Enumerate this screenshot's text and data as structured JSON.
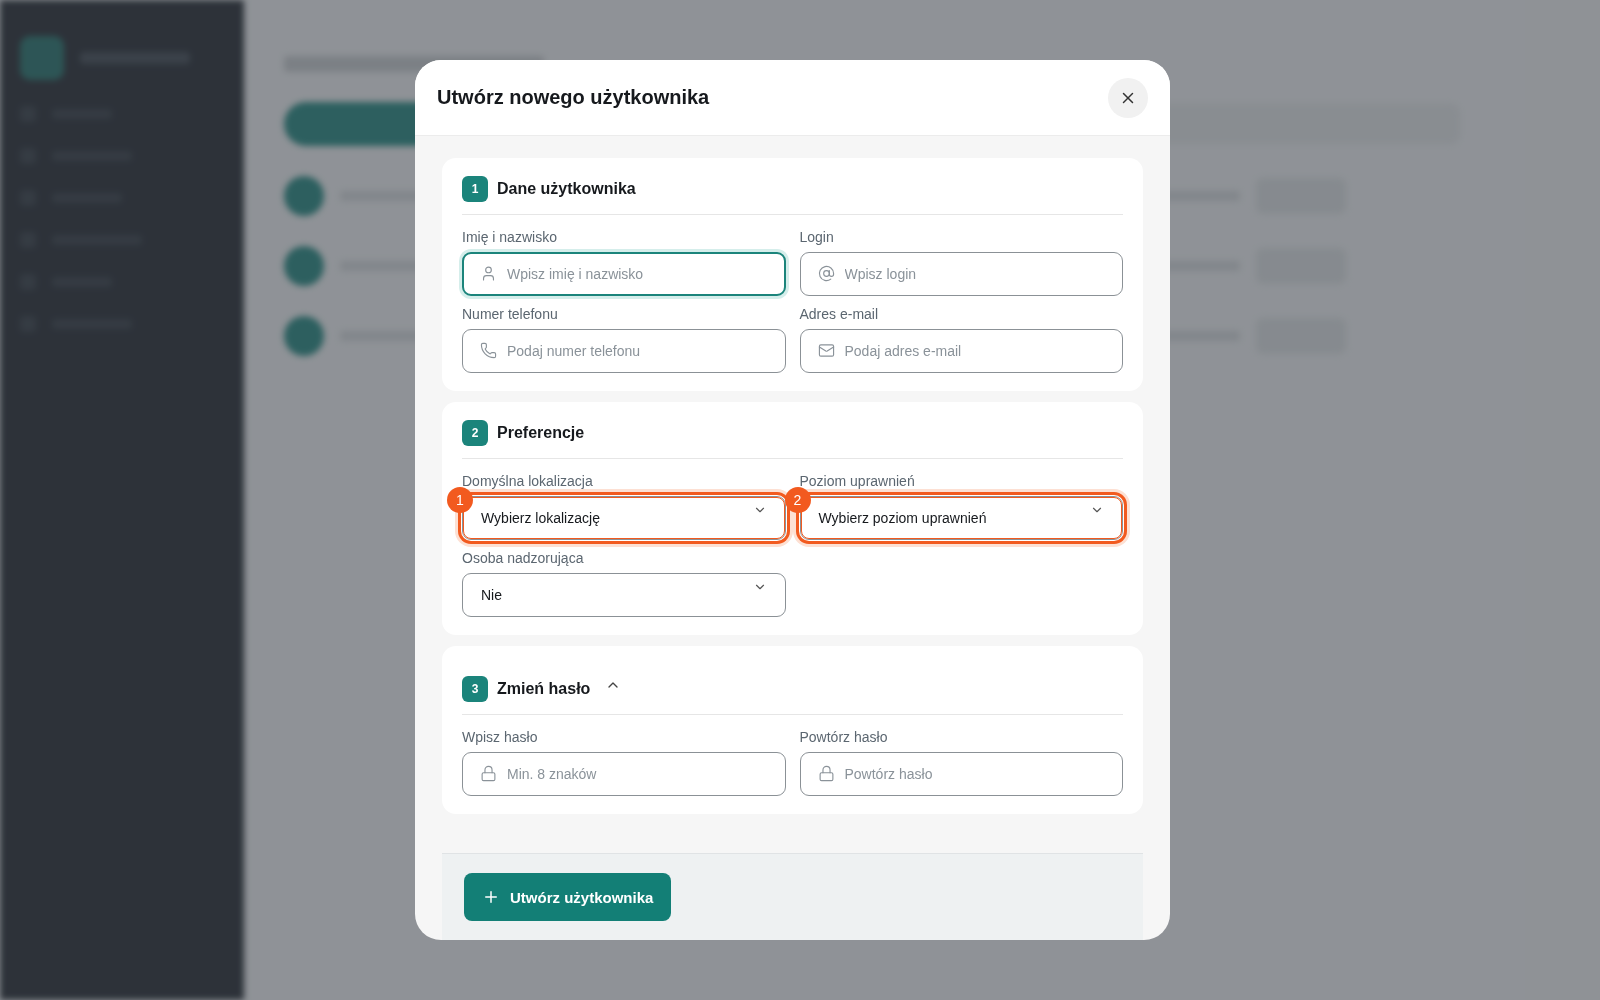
{
  "dialog": {
    "title": "Utwórz nowego użytkownika",
    "sections": [
      {
        "number": "1",
        "title": "Dane użytkownika",
        "fields": [
          {
            "kind": "name",
            "label": "Imię i nazwisko",
            "placeholder": "Wpisz imię i nazwisko",
            "focused": true
          },
          {
            "kind": "login",
            "label": "Login",
            "placeholder": "Wpisz login",
            "focused": false
          },
          {
            "kind": "phone",
            "label": "Numer telefonu",
            "placeholder": "Podaj numer telefonu",
            "focused": false
          },
          {
            "kind": "email",
            "label": "Adres e-mail",
            "placeholder": "Podaj adres e-mail",
            "focused": false
          }
        ]
      },
      {
        "number": "2",
        "title": "Preferencje",
        "fields": [
          {
            "kind": "select",
            "label": "Domyślna lokalizacja",
            "value": "Wybierz lokalizację",
            "highlighted": true,
            "annotation": "1"
          },
          {
            "kind": "select",
            "label": "Poziom uprawnień",
            "value": "Wybierz poziom uprawnień",
            "highlighted": true,
            "annotation": "2"
          },
          {
            "kind": "select",
            "label": "Osoba nadzorująca",
            "value": "Nie",
            "highlighted": false
          }
        ]
      },
      {
        "number": "3",
        "title": "Zmień hasło",
        "expanded": true,
        "fields": [
          {
            "kind": "password",
            "label": "Wpisz hasło",
            "placeholder": "Min. 8 znaków",
            "focused": false
          },
          {
            "kind": "password",
            "label": "Powtórz hasło",
            "placeholder": "Powtórz hasło",
            "focused": false
          }
        ]
      }
    ],
    "submit": {
      "label": "Utwórz użytkownika"
    }
  }
}
